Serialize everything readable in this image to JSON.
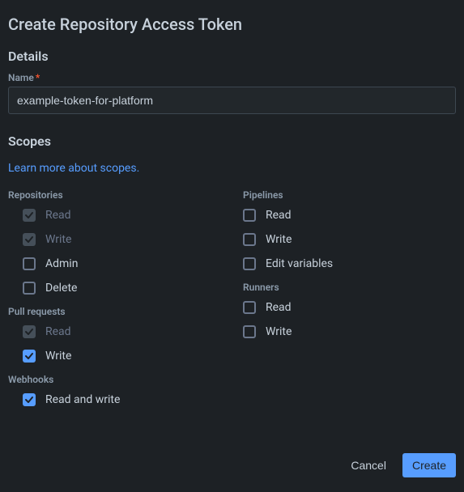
{
  "title": "Create Repository Access Token",
  "details": {
    "heading": "Details",
    "name_label": "Name",
    "name_value": "example-token-for-platform"
  },
  "scopes": {
    "heading": "Scopes",
    "learn_more": "Learn more about scopes.",
    "left": {
      "repositories": {
        "label": "Repositories",
        "items": [
          {
            "label": "Read",
            "checked": true,
            "disabled": true
          },
          {
            "label": "Write",
            "checked": true,
            "disabled": true
          },
          {
            "label": "Admin",
            "checked": false,
            "disabled": false
          },
          {
            "label": "Delete",
            "checked": false,
            "disabled": false
          }
        ]
      },
      "pullrequests": {
        "label": "Pull requests",
        "items": [
          {
            "label": "Read",
            "checked": true,
            "disabled": true
          },
          {
            "label": "Write",
            "checked": true,
            "disabled": false
          }
        ]
      },
      "webhooks": {
        "label": "Webhooks",
        "items": [
          {
            "label": "Read and write",
            "checked": true,
            "disabled": false
          }
        ]
      }
    },
    "right": {
      "pipelines": {
        "label": "Pipelines",
        "items": [
          {
            "label": "Read",
            "checked": false,
            "disabled": false
          },
          {
            "label": "Write",
            "checked": false,
            "disabled": false
          },
          {
            "label": "Edit variables",
            "checked": false,
            "disabled": false
          }
        ]
      },
      "runners": {
        "label": "Runners",
        "items": [
          {
            "label": "Read",
            "checked": false,
            "disabled": false
          },
          {
            "label": "Write",
            "checked": false,
            "disabled": false
          }
        ]
      }
    }
  },
  "footer": {
    "cancel": "Cancel",
    "create": "Create"
  }
}
